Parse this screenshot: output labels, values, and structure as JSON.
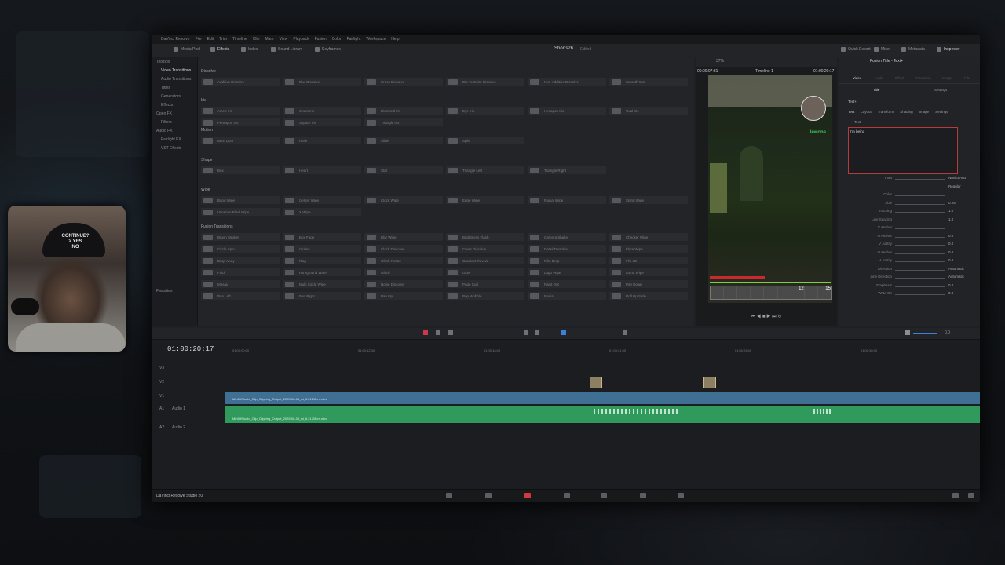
{
  "app": {
    "menu": [
      "DaVinci Resolve",
      "File",
      "Edit",
      "Trim",
      "Timeline",
      "Clip",
      "Mark",
      "View",
      "Playback",
      "Fusion",
      "Color",
      "Fairlight",
      "Workspace",
      "Help"
    ],
    "toolbar": {
      "left": [
        "Media Pool",
        "Effects",
        "Index",
        "Sound Library",
        "Keyframes"
      ],
      "project_title": "Shorts26",
      "project_status": "Edited",
      "right": [
        "Quick Export",
        "Mixer",
        "Metadata",
        "Inspector"
      ]
    },
    "footer_brand": "DaVinci Resolve Studio 20"
  },
  "sidebar": {
    "items": [
      "Toolbox",
      "Video Transitions",
      "Audio Transitions",
      "Titles",
      "Generators",
      "Effects",
      "Open FX",
      "Filters",
      "Audio FX",
      "Fairlight FX",
      "VST Effects",
      "Favorites"
    ],
    "selected": "Video Transitions"
  },
  "effects": {
    "sections": [
      {
        "title": "Dissolve",
        "items": [
          "Additive Dissolve",
          "Blur Dissolve",
          "Cross Dissolve",
          "Dip To Color Dissolve",
          "Non-Additive Dissolve",
          "Smooth Cut"
        ]
      },
      {
        "title": "Iris",
        "items": [
          "Arrow Iris",
          "Cross Iris",
          "Diamond Iris",
          "Eye Iris",
          "Hexagon Iris",
          "Oval Iris",
          "Pentagon Iris",
          "Square Iris",
          "Triangle Iris"
        ]
      },
      {
        "title": "Motion",
        "items": [
          "Barn Door",
          "Push",
          "Slide",
          "Split"
        ]
      },
      {
        "title": "Shape",
        "items": [
          "Box",
          "Heart",
          "Star",
          "Triangle Left",
          "Triangle Right"
        ]
      },
      {
        "title": "Wipe",
        "items": [
          "Band Wipe",
          "Center Wipe",
          "Clock Wipe",
          "Edge Wipe",
          "Radial Wipe",
          "Spiral Wipe",
          "Venetian Blind Wipe",
          "X Wipe"
        ]
      },
      {
        "title": "Fusion Transitions",
        "items": [
          "Brush Strokes",
          "Box Fade",
          "Blur Wipe",
          "Brightness Flash",
          "Camera Shake",
          "Checker Wipe",
          "Circle Spin",
          "Circles",
          "Clock Dissolve",
          "Cross Dissolve",
          "Detail Dissolve",
          "Flare Wipe",
          "Drop Away",
          "Flag",
          "Glitch Rotate",
          "Gradient Reveal",
          "Film Drop",
          "Flip 3D",
          "Fold",
          "Foreground Wipe",
          "Glitch",
          "Glow",
          "Logo Wipe",
          "Luma Wipe",
          "Mosaic",
          "Multi Circle Wipe",
          "Noise Dissolve",
          "Page Curl",
          "Paint Out",
          "Pan Down",
          "Pan Left",
          "Pan Right",
          "Pan Up",
          "Pop Wobble",
          "Radial",
          "Roll Up Slide"
        ]
      }
    ]
  },
  "viewer": {
    "zoom": "37%",
    "timecode_left": "00:00:07:31",
    "timeline_name": "Timeline 1",
    "timecode_right": "01:00:20:17",
    "streamer_tag": "/ewone",
    "hud_numbers": [
      "12",
      "15"
    ]
  },
  "inspector": {
    "title": "Fusion Title - Text+",
    "tabs": [
      "Video",
      "Audio",
      "Effect",
      "Transition",
      "Image",
      "File"
    ],
    "subtabs": [
      "Title",
      "Settings"
    ],
    "node": "Text+",
    "node_tabs": [
      "Text",
      "Layout",
      "Transform",
      "Shading",
      "Image",
      "Settings"
    ],
    "section": "Text",
    "text_value": "I'm being",
    "rows": [
      {
        "label": "Font",
        "value": "Nunito Ano"
      },
      {
        "label": "",
        "value": "Regular"
      },
      {
        "label": "Color",
        "value": ""
      },
      {
        "label": "Size",
        "value": "0.25"
      },
      {
        "label": "Tracking",
        "value": "1.0"
      },
      {
        "label": "Line Spacing",
        "value": "1.0"
      },
      {
        "label": "V Anchor",
        "value": ""
      },
      {
        "label": "H Anchor",
        "value": "0.0"
      },
      {
        "label": "V Justify",
        "value": "0.0"
      },
      {
        "label": "H Anchor",
        "value": "0.0"
      },
      {
        "label": "H Justify",
        "value": "0.0"
      },
      {
        "label": "Direction",
        "value": "Automatic"
      },
      {
        "label": "Line Direction",
        "value": "Automatic"
      },
      {
        "label": "Emphasis",
        "value": "0.0"
      },
      {
        "label": "Write On",
        "value": "0.0"
      }
    ]
  },
  "timeline": {
    "timecode": "01:00:20:17",
    "ruler": [
      "01:00:00:00",
      "01:00:12:00",
      "01:00:18:00",
      "01:00:21:00",
      "01:00:24:00",
      "01:00:30:00"
    ],
    "tracks": [
      {
        "id": "V3",
        "name": ""
      },
      {
        "id": "V2",
        "name": ""
      },
      {
        "id": "V1",
        "name": ""
      },
      {
        "id": "A1",
        "name": "Audio 1"
      },
      {
        "id": "A2",
        "name": "Audio 2"
      }
    ],
    "video_clip": "MinBitStudio_Clip_Clipping_Output_2025-08-01_at_6.21.28pm.mkv",
    "audio_clip": "MinBitStudio_Clip_Clipping_Output_2025-08-01_at_6.21.28pm.mkv",
    "level": "0.0"
  },
  "webcam": {
    "cap_text": "CONTINUE?\n> YES\nNO"
  },
  "colors": {
    "accent": "#d2393e",
    "video_clip": "#3f6f93",
    "audio_clip": "#2f9a5b"
  }
}
